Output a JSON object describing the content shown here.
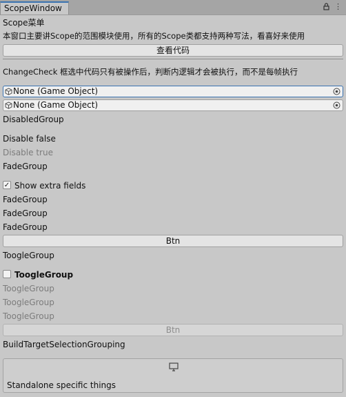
{
  "window": {
    "tab_title": "ScopeWindow",
    "icons": [
      "lock-icon",
      "menu-icon"
    ]
  },
  "scope_menu_label": "Scope菜单",
  "intro_text": "本窗口主要讲Scope的范围模块使用，所有的Scope类都支持两种写法，看喜好来使用",
  "view_code_button": "查看代码",
  "change_check_text": "ChangeCheck 框选中代码只有被操作后，判断内逻辑才会被执行，而不是每帧执行",
  "object_fields": [
    "None (Game Object)",
    "None (Game Object)"
  ],
  "disabled_group": {
    "title": "DisabledGroup",
    "disable_false": "Disable false",
    "disable_true": "Disable true"
  },
  "fade_group": {
    "title": "FadeGroup",
    "toggle_label": "Show extra fields",
    "toggle_checked": true,
    "items": [
      "FadeGroup",
      "FadeGroup",
      "FadeGroup"
    ],
    "button": "Btn"
  },
  "toggle_group": {
    "title": "ToogleGroup",
    "toggle_label": "ToogleGroup",
    "toggle_checked": false,
    "items": [
      "ToogleGroup",
      "ToogleGroup",
      "ToogleGroup"
    ],
    "button": "Btn"
  },
  "build_target": {
    "title": "BuildTargetSelectionGrouping",
    "platform_icon": "monitor-icon",
    "content": "Standalone specific things"
  },
  "colors": {
    "background": "#c8c8c8",
    "accent": "#3a72b0",
    "disabled_text": "#7c7c7c"
  }
}
